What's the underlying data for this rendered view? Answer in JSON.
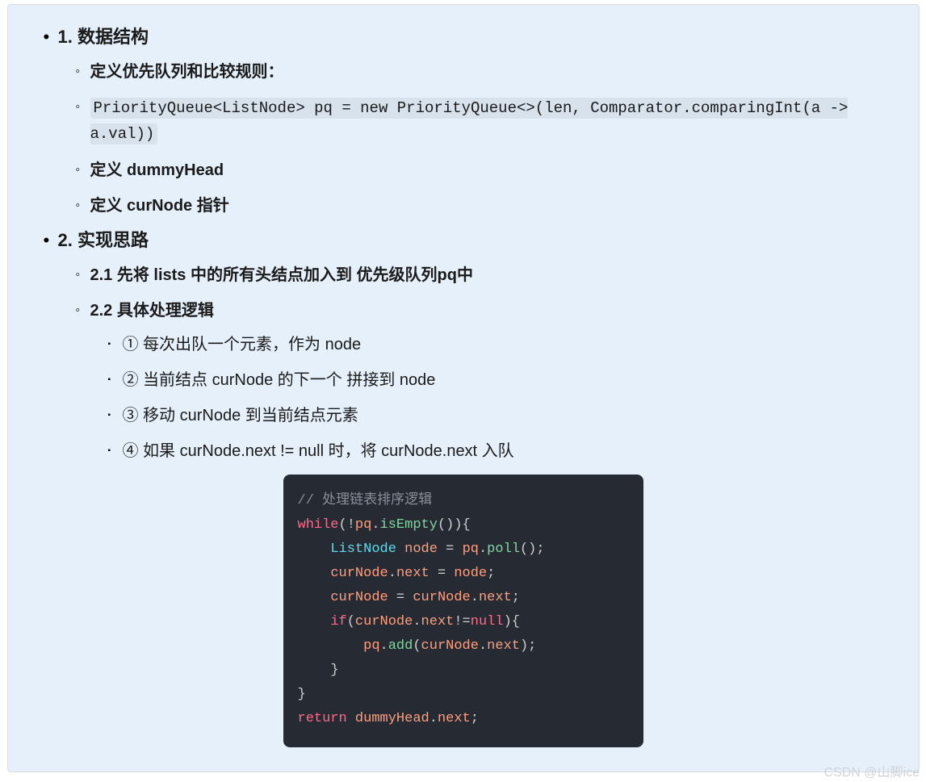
{
  "outline": {
    "sec1": {
      "title": "1. 数据结构",
      "items": {
        "i1": "定义优先队列和比较规则：",
        "i2_code": "PriorityQueue<ListNode> pq = new PriorityQueue<>(len, Comparator.comparingInt(a -> a.val))",
        "i3": "定义 dummyHead",
        "i4": "定义 curNode 指针"
      }
    },
    "sec2": {
      "title": "2. 实现思路",
      "sub1": "2.1 先将 lists 中的所有头结点加入到 优先级队列pq中",
      "sub2": {
        "title": "2.2 具体处理逻辑",
        "steps": {
          "s1": "① 每次出队一个元素，作为 node",
          "s2": "② 当前结点 curNode 的下一个 拼接到 node",
          "s3": "③ 移动 curNode 到当前结点元素",
          "s4": "④ 如果 curNode.next != null 时，将 curNode.next 入队"
        }
      }
    }
  },
  "code": {
    "l1_comment": "// 处理链表排序逻辑",
    "l2": {
      "kw": "while",
      "punct1": "(!",
      "var": "pq",
      "dot": ".",
      "meth": "isEmpty",
      "punct2": "()){"
    },
    "l3": {
      "indent": "    ",
      "type": "ListNode",
      "sp": " ",
      "var": "node",
      "eq": " = ",
      "var2": "pq",
      "dot": ".",
      "meth": "poll",
      "punct": "();"
    },
    "l4": {
      "indent": "    ",
      "var": "curNode",
      "dot": ".",
      "prop": "next",
      "eq": " = ",
      "var2": "node",
      "punct": ";"
    },
    "l5": {
      "indent": "    ",
      "var": "curNode",
      "eq": " = ",
      "var2": "curNode",
      "dot": ".",
      "prop": "next",
      "punct": ";"
    },
    "l6": {
      "indent": "    ",
      "kw": "if",
      "p1": "(",
      "var": "curNode",
      "dot": ".",
      "prop": "next",
      "neq": "!=",
      "nul": "null",
      "p2": "){"
    },
    "l7": {
      "indent": "        ",
      "var": "pq",
      "dot": ".",
      "meth": "add",
      "p1": "(",
      "var2": "curNode",
      "dot2": ".",
      "prop": "next",
      "p2": ");"
    },
    "l8": {
      "indent": "    ",
      "brace": "}"
    },
    "l9": {
      "brace": "}"
    },
    "l10": {
      "kw": "return",
      "sp": " ",
      "var": "dummyHead",
      "dot": ".",
      "prop": "next",
      "punct": ";"
    }
  },
  "watermark": "CSDN @山脚ice"
}
